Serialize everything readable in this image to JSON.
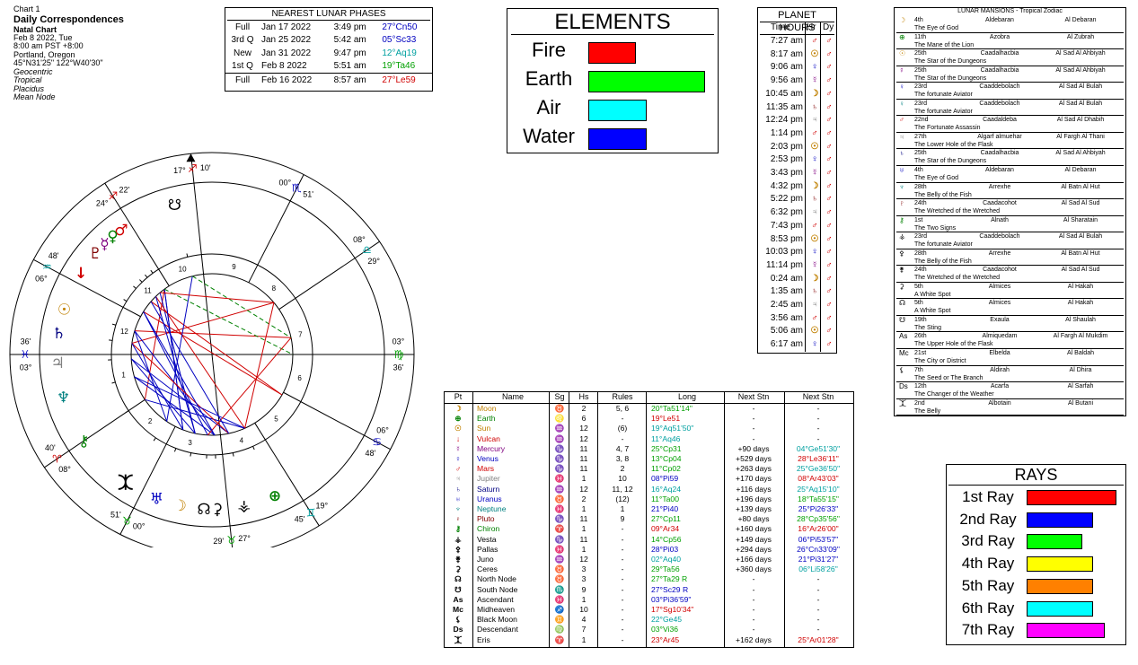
{
  "header": {
    "chart_no": "Chart 1",
    "title": "Daily Correspondences",
    "subtitle": "Natal Chart",
    "date": "Feb 8 2022, Tue",
    "time": "8:00 am  PST +8:00",
    "place": "Portland, Oregon",
    "coords": "45°N31'25\"  122°W40'30\"",
    "opts": [
      "Geocentric",
      "Tropical",
      "Placidus",
      "Mean Node"
    ]
  },
  "lunar_phases": {
    "title": "NEAREST LUNAR PHASES",
    "rows": [
      {
        "phase": "Full",
        "date": "Jan 17 2022",
        "time": "3:49 pm",
        "pos": "27°Cn50",
        "color": "#0000c0"
      },
      {
        "phase": "3rd Q",
        "date": "Jan 25 2022",
        "time": "5:42 am",
        "pos": "05°Sc33",
        "color": "#0000c0"
      },
      {
        "phase": "New",
        "date": "Jan 31 2022",
        "time": "9:47 pm",
        "pos": "12°Aq19",
        "color": "#00a0a0"
      },
      {
        "phase": "1st Q",
        "date": "Feb 8 2022",
        "time": "5:51 am",
        "pos": "19°Ta46",
        "color": "#00a000"
      },
      {
        "phase": "Full",
        "date": "Feb 16 2022",
        "time": "8:57 am",
        "pos": "27°Le59",
        "color": "#d00000"
      }
    ]
  },
  "elements": {
    "title": "ELEMENTS",
    "items": [
      {
        "label": "Fire",
        "value": 0.41,
        "color": "#ff0000"
      },
      {
        "label": "Earth",
        "value": 1.0,
        "color": "#00ff00"
      },
      {
        "label": "Air",
        "value": 0.5,
        "color": "#00ffff"
      },
      {
        "label": "Water",
        "value": 0.5,
        "color": "#0000ff"
      }
    ]
  },
  "planet_hours": {
    "title": "PLANET HOURS",
    "col_time": "Time",
    "col_hr": "Hr",
    "col_dy": "Dy",
    "rows": [
      {
        "time": "7:27 am",
        "hr": "♂",
        "hc": "#d00000"
      },
      {
        "time": "8:17 am",
        "hr": "☉",
        "hc": "#c08000"
      },
      {
        "time": "9:06 am",
        "hr": "♀",
        "hc": "#0000c0"
      },
      {
        "time": "9:56 am",
        "hr": "☿",
        "hc": "#800080"
      },
      {
        "time": "10:45 am",
        "hr": "☽",
        "hc": "#c08000"
      },
      {
        "time": "11:35 am",
        "hr": "♄",
        "hc": "#800000"
      },
      {
        "time": "12:24 pm",
        "hr": "♃",
        "hc": "#808080"
      },
      {
        "time": "1:14 pm",
        "hr": "♂",
        "hc": "#d00000"
      },
      {
        "time": "2:03 pm",
        "hr": "☉",
        "hc": "#c08000"
      },
      {
        "time": "2:53 pm",
        "hr": "♀",
        "hc": "#0000c0"
      },
      {
        "time": "3:43 pm",
        "hr": "☿",
        "hc": "#800080"
      },
      {
        "time": "4:32 pm",
        "hr": "☽",
        "hc": "#c08000"
      },
      {
        "time": "5:22 pm",
        "hr": "♄",
        "hc": "#800000"
      },
      {
        "time": "6:32 pm",
        "hr": "♃",
        "hc": "#808080"
      },
      {
        "time": "7:43 pm",
        "hr": "♂",
        "hc": "#d00000"
      },
      {
        "time": "8:53 pm",
        "hr": "☉",
        "hc": "#c08000"
      },
      {
        "time": "10:03 pm",
        "hr": "♀",
        "hc": "#0000c0"
      },
      {
        "time": "11:14 pm",
        "hr": "☿",
        "hc": "#800080"
      },
      {
        "time": "0:24 am",
        "hr": "☽",
        "hc": "#c08000"
      },
      {
        "time": "1:35 am",
        "hr": "♄",
        "hc": "#800000"
      },
      {
        "time": "2:45 am",
        "hr": "♃",
        "hc": "#808080"
      },
      {
        "time": "3:56 am",
        "hr": "♂",
        "hc": "#d00000"
      },
      {
        "time": "5:06 am",
        "hr": "☉",
        "hc": "#c08000"
      },
      {
        "time": "6:17 am",
        "hr": "♀",
        "hc": "#0000c0"
      }
    ],
    "day_ruler": "♂",
    "day_color": "#d00000"
  },
  "mansions": {
    "title": "LUNAR MANSIONS - Tropical Zodiac",
    "rows": [
      {
        "icon": "☽",
        "deg": "4th",
        "name": "Aldebaran",
        "arabic": "Al Debaran",
        "desc": "The Eye of God",
        "c": "#c08000"
      },
      {
        "icon": "⊕",
        "deg": "11th",
        "name": "Azobra",
        "arabic": "Al Zubrah",
        "desc": "The Mane of the Lion",
        "c": "#008000"
      },
      {
        "icon": "☉",
        "deg": "25th",
        "name": "Caadalhacbia",
        "arabic": "Al Sad Al Ahbiyah",
        "desc": "The Star of the Dungeons",
        "c": "#c08000"
      },
      {
        "icon": "☿",
        "deg": "25th",
        "name": "Caadalhacbia",
        "arabic": "Al Sad Al Ahbiyah",
        "desc": "The Star of the Dungeons",
        "c": "#800080"
      },
      {
        "icon": "♀",
        "deg": "23rd",
        "name": "Caaddebolach",
        "arabic": "Al Sad Al Bulah",
        "desc": "The fortunate Aviator",
        "c": "#0000c0"
      },
      {
        "icon": "♀",
        "deg": "23rd",
        "name": "Caaddebolach",
        "arabic": "Al Sad Al Bulah",
        "desc": "The fortunate Aviator",
        "c": "#008080"
      },
      {
        "icon": "♂",
        "deg": "22nd",
        "name": "Caadaldeba",
        "arabic": "Al Sad Al Dhabih",
        "desc": "The Fortunate Assassin",
        "c": "#d00000"
      },
      {
        "icon": "♃",
        "deg": "27th",
        "name": "Algarf almuehar",
        "arabic": "Al Fargh Al Thani",
        "desc": "The Lower Hole of the Flask",
        "c": "#808080"
      },
      {
        "icon": "♄",
        "deg": "25th",
        "name": "Caadalhacbia",
        "arabic": "Al Sad Al Ahbiyah",
        "desc": "The Star of the Dungeons",
        "c": "#000080"
      },
      {
        "icon": "♅",
        "deg": "4th",
        "name": "Aldebaran",
        "arabic": "Al Debaran",
        "desc": "The Eye of God",
        "c": "#0000c0"
      },
      {
        "icon": "♆",
        "deg": "28th",
        "name": "Arrexhe",
        "arabic": "Al Batn Al Hut",
        "desc": "The Belly of the Fish",
        "c": "#008080"
      },
      {
        "icon": "♇",
        "deg": "24th",
        "name": "Caadacohot",
        "arabic": "Al Sad Al Sud",
        "desc": "The Wretched of the Wretched",
        "c": "#800000"
      },
      {
        "icon": "⚷",
        "deg": "1st",
        "name": "Alnath",
        "arabic": "Al Sharatain",
        "desc": "The Two Signs",
        "c": "#008000"
      },
      {
        "icon": "⚶",
        "deg": "23rd",
        "name": "Caaddebolach",
        "arabic": "Al Sad Al Bulah",
        "desc": "The fortunate Aviator",
        "c": "#000000"
      },
      {
        "icon": "⚴",
        "deg": "28th",
        "name": "Arrexhe",
        "arabic": "Al Batn Al Hut",
        "desc": "The Belly of the Fish",
        "c": "#000000"
      },
      {
        "icon": "⚵",
        "deg": "24th",
        "name": "Caadacohot",
        "arabic": "Al Sad Al Sud",
        "desc": "The Wretched of the Wretched",
        "c": "#000000"
      },
      {
        "icon": "⚳",
        "deg": "5th",
        "name": "Almices",
        "arabic": "Al Hakah",
        "desc": "A White Spot",
        "c": "#000000"
      },
      {
        "icon": "☊",
        "deg": "5th",
        "name": "Almices",
        "arabic": "Al Hakah",
        "desc": "A White Spot",
        "c": "#000000"
      },
      {
        "icon": "☋",
        "deg": "19th",
        "name": "Exaula",
        "arabic": "Al Shaulah",
        "desc": "The Sting",
        "c": "#000000"
      },
      {
        "icon": "As",
        "deg": "26th",
        "name": "Almiquedam",
        "arabic": "Al Fargh Al Mukdim",
        "desc": "The Upper Hole of the Flask",
        "c": "#000000"
      },
      {
        "icon": "Mc",
        "deg": "21st",
        "name": "Elbelda",
        "arabic": "Al Baldah",
        "desc": "The City or District",
        "c": "#000000"
      },
      {
        "icon": "⚸",
        "deg": "7th",
        "name": "Aldirah",
        "arabic": "Al Dhira",
        "desc": "The Seed or The Branch",
        "c": "#000000"
      },
      {
        "icon": "Ds",
        "deg": "12th",
        "name": "Acarfa",
        "arabic": "Al Sarfah",
        "desc": "The Changer of the Weather",
        "c": "#000000"
      },
      {
        "icon": "⯰",
        "deg": "2nd",
        "name": "Albotain",
        "arabic": "Al Butani",
        "desc": "The Belly",
        "c": "#000000"
      }
    ]
  },
  "planet_table": {
    "headers": [
      "Pt",
      "Name",
      "Sg",
      "Hs",
      "Rules",
      "Long",
      "Next Stn",
      "Next Stn"
    ],
    "rows": [
      {
        "ic": "☽",
        "name": "Moon",
        "sg": "♉",
        "hs": "2",
        "ru": "5, 6",
        "lg": "20°Ta51'14\"",
        "ns": "-",
        "nx": "-",
        "c": "#c08000",
        "lc": "#00a000",
        "xc": "#000"
      },
      {
        "ic": "⊕",
        "name": "Earth",
        "sg": "♌",
        "hs": "6",
        "ru": "-",
        "lg": "19°Le51",
        "ns": "-",
        "nx": "-",
        "c": "#008000",
        "lc": "#d00000",
        "xc": "#000"
      },
      {
        "ic": "☉",
        "name": "Sun",
        "sg": "♒",
        "hs": "12",
        "ru": "(6)",
        "lg": "19°Aq51'50\"",
        "ns": "-",
        "nx": "-",
        "c": "#c08000",
        "lc": "#00a0a0",
        "xc": "#000"
      },
      {
        "ic": "↓",
        "name": "Vulcan",
        "sg": "♒",
        "hs": "12",
        "ru": "-",
        "lg": "11°Aq46",
        "ns": "-",
        "nx": "-",
        "c": "#d00000",
        "lc": "#00a0a0",
        "xc": "#000"
      },
      {
        "ic": "☿",
        "name": "Mercury",
        "sg": "♑",
        "hs": "11",
        "ru": "4, 7",
        "lg": "25°Cp31",
        "ns": "+90 days",
        "nx": "04°Ge51'30\"",
        "c": "#800080",
        "lc": "#00a000",
        "xc": "#00a0a0"
      },
      {
        "ic": "♀",
        "name": "Venus",
        "sg": "♑",
        "hs": "11",
        "ru": "3, 8",
        "lg": "13°Cp04",
        "ns": "+529 days",
        "nx": "28°Le36'11\"",
        "c": "#0000c0",
        "lc": "#00a000",
        "xc": "#d00000"
      },
      {
        "ic": "♂",
        "name": "Mars",
        "sg": "♑",
        "hs": "11",
        "ru": "2",
        "lg": "11°Cp02",
        "ns": "+263 days",
        "nx": "25°Ge36'50\"",
        "c": "#d00000",
        "lc": "#00a000",
        "xc": "#00a0a0"
      },
      {
        "ic": "♃",
        "name": "Jupiter",
        "sg": "♓",
        "hs": "1",
        "ru": "10",
        "lg": "08°Pi59",
        "ns": "+170 days",
        "nx": "08°Ar43'03\"",
        "c": "#808080",
        "lc": "#0000c0",
        "xc": "#d00000"
      },
      {
        "ic": "♄",
        "name": "Saturn",
        "sg": "♒",
        "hs": "12",
        "ru": "11, 12",
        "lg": "16°Aq24",
        "ns": "+116 days",
        "nx": "25°Aq15'10\"",
        "c": "#000080",
        "lc": "#00a0a0",
        "xc": "#00a0a0"
      },
      {
        "ic": "♅",
        "name": "Uranus",
        "sg": "♉",
        "hs": "2",
        "ru": "(12)",
        "lg": "11°Ta00",
        "ns": "+196 days",
        "nx": "18°Ta55'15\"",
        "c": "#0000c0",
        "lc": "#00a000",
        "xc": "#00a000"
      },
      {
        "ic": "♆",
        "name": "Neptune",
        "sg": "♓",
        "hs": "1",
        "ru": "1",
        "lg": "21°Pi40",
        "ns": "+139 days",
        "nx": "25°Pi26'33\"",
        "c": "#008080",
        "lc": "#0000c0",
        "xc": "#0000c0"
      },
      {
        "ic": "♇",
        "name": "Pluto",
        "sg": "♑",
        "hs": "11",
        "ru": "9",
        "lg": "27°Cp11",
        "ns": "+80 days",
        "nx": "28°Cp35'56\"",
        "c": "#800000",
        "lc": "#00a000",
        "xc": "#00a000"
      },
      {
        "ic": "⚷",
        "name": "Chiron",
        "sg": "♈",
        "hs": "1",
        "ru": "-",
        "lg": "09°Ar34",
        "ns": "+160 days",
        "nx": "16°Ar26'00\"",
        "c": "#008000",
        "lc": "#d00000",
        "xc": "#d00000"
      },
      {
        "ic": "⚶",
        "name": "Vesta",
        "sg": "♑",
        "hs": "11",
        "ru": "-",
        "lg": "14°Cp56",
        "ns": "+149 days",
        "nx": "06°Pi53'57\"",
        "c": "#000",
        "lc": "#00a000",
        "xc": "#0000c0"
      },
      {
        "ic": "⚴",
        "name": "Pallas",
        "sg": "♓",
        "hs": "1",
        "ru": "-",
        "lg": "28°Pi03",
        "ns": "+294 days",
        "nx": "26°Cn33'09\"",
        "c": "#000",
        "lc": "#0000c0",
        "xc": "#0000c0"
      },
      {
        "ic": "⚵",
        "name": "Juno",
        "sg": "♒",
        "hs": "12",
        "ru": "-",
        "lg": "02°Aq40",
        "ns": "+166 days",
        "nx": "21°Pi31'27\"",
        "c": "#000",
        "lc": "#00a0a0",
        "xc": "#0000c0"
      },
      {
        "ic": "⚳",
        "name": "Ceres",
        "sg": "♉",
        "hs": "3",
        "ru": "-",
        "lg": "29°Ta56",
        "ns": "+360 days",
        "nx": "06°Li58'26\"",
        "c": "#000",
        "lc": "#00a000",
        "xc": "#00a0a0"
      },
      {
        "ic": "☊",
        "name": "North Node",
        "sg": "♉",
        "hs": "3",
        "ru": "-",
        "lg": "27°Ta29 R",
        "ns": "-",
        "nx": "-",
        "c": "#000",
        "lc": "#00a000",
        "xc": "#000"
      },
      {
        "ic": "☋",
        "name": "South Node",
        "sg": "♏",
        "hs": "9",
        "ru": "-",
        "lg": "27°Sc29 R",
        "ns": "-",
        "nx": "-",
        "c": "#000",
        "lc": "#0000c0",
        "xc": "#000"
      },
      {
        "ic": "As",
        "name": "Ascendant",
        "sg": "♓",
        "hs": "1",
        "ru": "-",
        "lg": "03°Pi36'59\"",
        "ns": "-",
        "nx": "-",
        "c": "#000",
        "lc": "#0000c0",
        "xc": "#000"
      },
      {
        "ic": "Mc",
        "name": "Midheaven",
        "sg": "♐",
        "hs": "10",
        "ru": "-",
        "lg": "17°Sg10'34\"",
        "ns": "-",
        "nx": "-",
        "c": "#000",
        "lc": "#d00000",
        "xc": "#000"
      },
      {
        "ic": "⚸",
        "name": "Black Moon",
        "sg": "♊",
        "hs": "4",
        "ru": "-",
        "lg": "22°Ge45",
        "ns": "-",
        "nx": "-",
        "c": "#000",
        "lc": "#00a0a0",
        "xc": "#000"
      },
      {
        "ic": "Ds",
        "name": "Descendant",
        "sg": "♍",
        "hs": "7",
        "ru": "-",
        "lg": "03°Vi36",
        "ns": "-",
        "nx": "-",
        "c": "#000",
        "lc": "#00a000",
        "xc": "#000"
      },
      {
        "ic": "⯰",
        "name": "Eris",
        "sg": "♈",
        "hs": "1",
        "ru": "-",
        "lg": "23°Ar45",
        "ns": "+162 days",
        "nx": "25°Ar01'28\"",
        "c": "#000",
        "lc": "#d00000",
        "xc": "#d00000"
      }
    ]
  },
  "rays": {
    "title": "RAYS",
    "items": [
      {
        "label": "1st Ray",
        "value": 1.0,
        "color": "#ff0000"
      },
      {
        "label": "2nd Ray",
        "value": 0.74,
        "color": "#0000ff"
      },
      {
        "label": "3rd Ray",
        "value": 0.62,
        "color": "#00ff00"
      },
      {
        "label": "4th Ray",
        "value": 0.74,
        "color": "#ffff00"
      },
      {
        "label": "5th Ray",
        "value": 0.74,
        "color": "#ff8000"
      },
      {
        "label": "6th Ray",
        "value": 0.74,
        "color": "#00ffff"
      },
      {
        "label": "7th Ray",
        "value": 0.87,
        "color": "#ff00ff"
      }
    ]
  },
  "wheel": {
    "cusps": [
      {
        "deg": "03°",
        "sign": "♓",
        "mins": "36'",
        "sc": "#0000c0"
      },
      {
        "deg": "08°",
        "sign": "♈",
        "mins": "40'",
        "sc": "#d00000"
      },
      {
        "deg": "00°",
        "sign": "♉",
        "mins": "51'",
        "sc": "#00a000"
      },
      {
        "deg": "27°",
        "sign": "♉",
        "mins": "29'",
        "sc": "#00a000"
      },
      {
        "deg": "19°",
        "sign": "♊",
        "mins": "45'",
        "sc": "#00a0a0"
      },
      {
        "deg": "06°",
        "sign": "♋",
        "mins": "48'",
        "sc": "#0000c0"
      },
      {
        "deg": "03°",
        "sign": "♍",
        "mins": "36'",
        "sc": "#00a000"
      },
      {
        "deg": "08°",
        "sign": "♎",
        "mins": "29°",
        "sc": "#00a0a0"
      },
      {
        "deg": "00°",
        "sign": "♏",
        "mins": "51'",
        "sc": "#0000c0"
      },
      {
        "deg": "17°",
        "sign": "♐",
        "mins": "10'",
        "sc": "#d00000"
      },
      {
        "deg": "24°",
        "sign": "♐",
        "mins": "22'",
        "sc": "#d00000"
      },
      {
        "deg": "06°",
        "sign": "♒",
        "mins": "48'",
        "sc": "#00a0a0"
      }
    ],
    "planets": [
      {
        "sym": "♂",
        "c": "#d00000"
      },
      {
        "sym": "♀",
        "c": "#008000"
      },
      {
        "sym": "☿",
        "c": "#800080"
      },
      {
        "sym": "♇",
        "c": "#800000"
      },
      {
        "sym": "↓",
        "c": "#d00000"
      },
      {
        "sym": "☉",
        "c": "#c08000"
      },
      {
        "sym": "♄",
        "c": "#000080"
      },
      {
        "sym": "♃",
        "c": "#808080"
      },
      {
        "sym": "♆",
        "c": "#008080"
      },
      {
        "sym": "⚷",
        "c": "#008000"
      },
      {
        "sym": "⯰",
        "c": "#000000"
      },
      {
        "sym": "♅",
        "c": "#0000c0"
      },
      {
        "sym": "☽",
        "c": "#c08000"
      },
      {
        "sym": "☊",
        "c": "#000000"
      },
      {
        "sym": "⚳",
        "c": "#000000"
      },
      {
        "sym": "⚶",
        "c": "#000000"
      },
      {
        "sym": "⊕",
        "c": "#008000"
      },
      {
        "sym": "☋",
        "c": "#000000"
      }
    ]
  }
}
